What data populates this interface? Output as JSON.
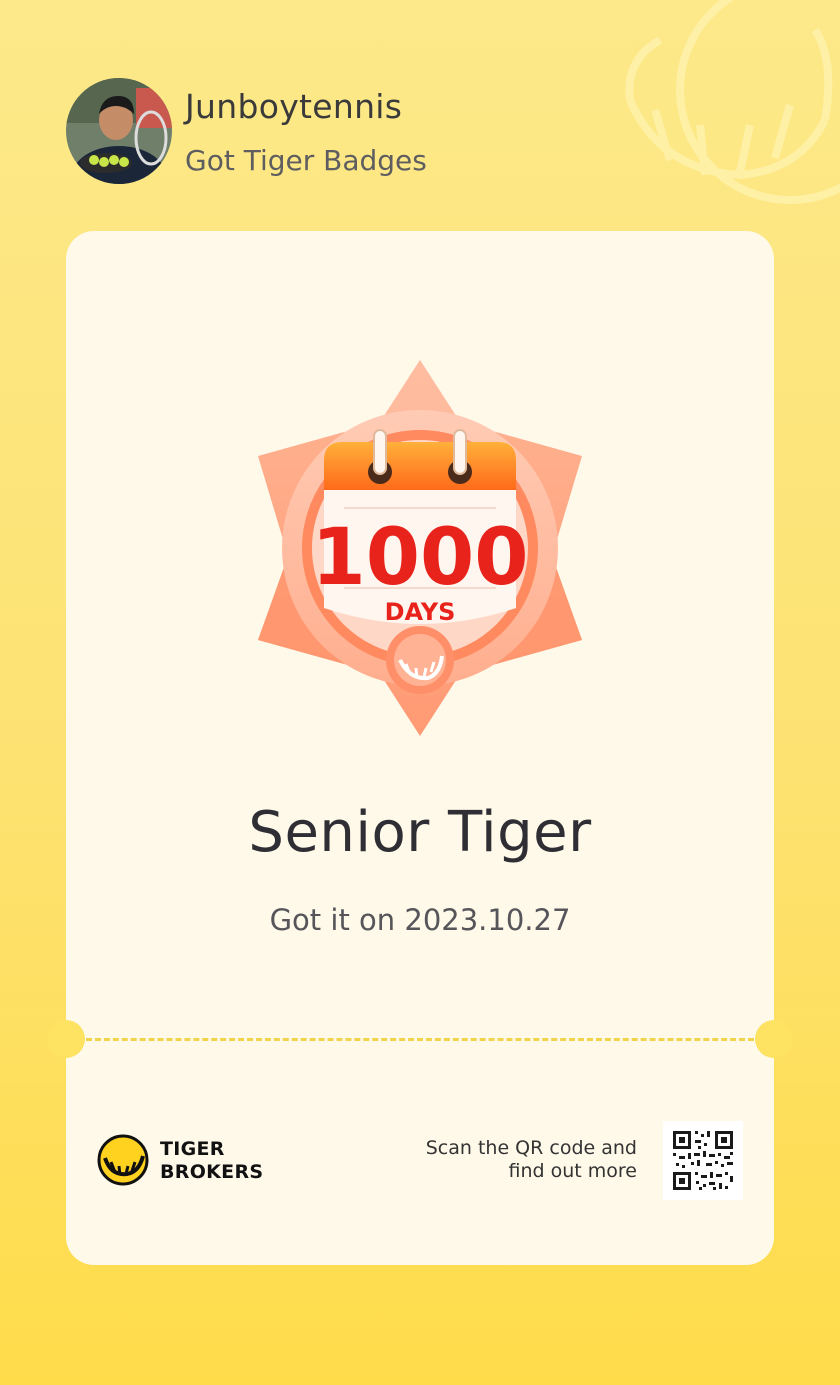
{
  "header": {
    "username": "Junboytennis",
    "subtitle": "Got Tiger Badges",
    "avatar_icon": "profile-photo"
  },
  "badge": {
    "icon": "calendar-1000-days-badge-icon",
    "count_text": "1000",
    "unit_text": "DAYS",
    "title": "Senior Tiger",
    "date_text": "Got it on 2023.10.27"
  },
  "footer": {
    "brand_line1": "TIGER",
    "brand_line2": "BROKERS",
    "scan_line1": "Scan the QR code and",
    "scan_line2": "find out more",
    "qr_icon": "qr-code-icon"
  },
  "colors": {
    "background": "#fde272",
    "card": "#fff9ea",
    "badge_orange": "#ff8f62",
    "badge_red": "#e8231c",
    "text_dark": "#2e2e34"
  }
}
